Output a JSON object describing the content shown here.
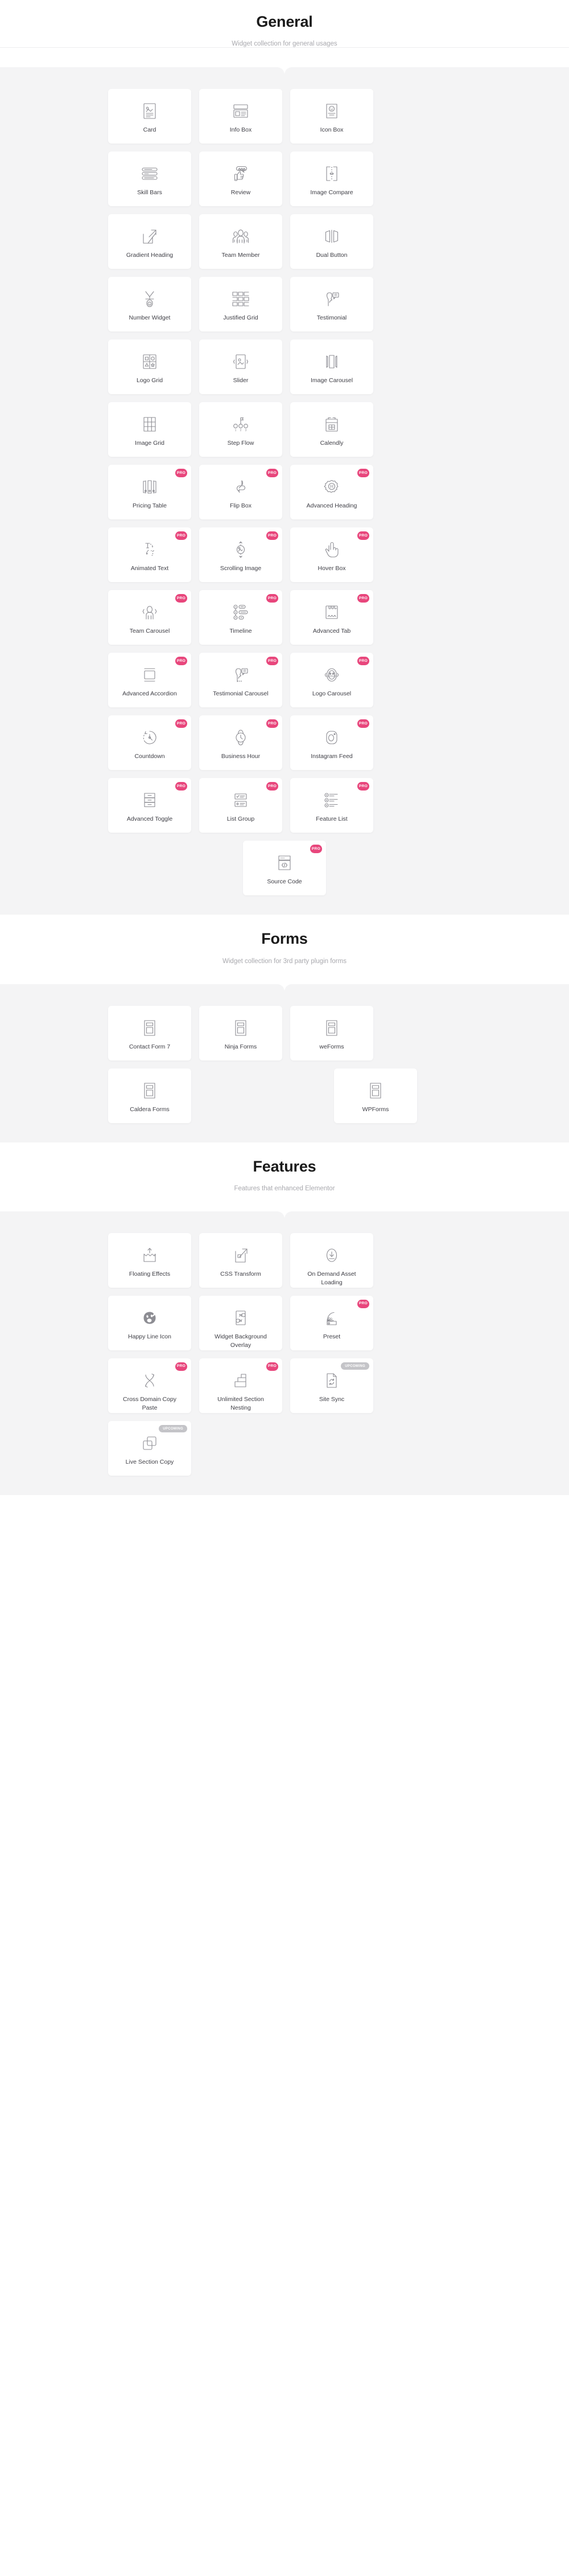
{
  "brand": {
    "pro_color": "#e8467c",
    "upcoming_color": "#c4c4c8",
    "band_background": "#f4f4f5",
    "card_background": "#ffffff",
    "icon_color": "#8d8d93"
  },
  "badges": {
    "pro": "PRO",
    "upcoming": "UPCOMING"
  },
  "sections": [
    {
      "id": "general",
      "title": "General",
      "subtitle": "Widget collection for general usages",
      "cards": [
        {
          "label": "Card",
          "icon": "card-icon",
          "badge": null
        },
        {
          "label": "Info Box",
          "icon": "info-box-icon",
          "badge": null
        },
        {
          "label": "Icon Box",
          "icon": "icon-box-icon",
          "badge": null
        },
        {
          "label": "Skill Bars",
          "icon": "skill-bars-icon",
          "badge": null
        },
        {
          "label": "Review",
          "icon": "review-icon",
          "badge": null
        },
        {
          "label": "Image Compare",
          "icon": "image-compare-icon",
          "badge": null
        },
        {
          "label": "Gradient Heading",
          "icon": "gradient-heading-icon",
          "badge": null
        },
        {
          "label": "Team Member",
          "icon": "team-member-icon",
          "badge": null
        },
        {
          "label": "Dual Button",
          "icon": "dual-button-icon",
          "badge": null
        },
        {
          "label": "Number Widget",
          "icon": "number-widget-icon",
          "badge": null
        },
        {
          "label": "Justified Grid",
          "icon": "justified-grid-icon",
          "badge": null
        },
        {
          "label": "Testimonial",
          "icon": "testimonial-icon",
          "badge": null
        },
        {
          "label": "Logo Grid",
          "icon": "logo-grid-icon",
          "badge": null
        },
        {
          "label": "Slider",
          "icon": "slider-icon",
          "badge": null
        },
        {
          "label": "Image Carousel",
          "icon": "image-carousel-icon",
          "badge": null
        },
        {
          "label": "Image Grid",
          "icon": "image-grid-icon",
          "badge": null
        },
        {
          "label": "Step Flow",
          "icon": "step-flow-icon",
          "badge": null
        },
        {
          "label": "Calendly",
          "icon": "calendly-icon",
          "badge": null
        },
        {
          "label": "Pricing Table",
          "icon": "pricing-table-icon",
          "badge": "PRO"
        },
        {
          "label": "Flip Box",
          "icon": "flip-box-icon",
          "badge": "PRO"
        },
        {
          "label": "Advanced Heading",
          "icon": "advanced-heading-icon",
          "badge": "PRO"
        },
        {
          "label": "Animated Text",
          "icon": "animated-text-icon",
          "badge": "PRO"
        },
        {
          "label": "Scrolling Image",
          "icon": "scrolling-image-icon",
          "badge": "PRO"
        },
        {
          "label": "Hover Box",
          "icon": "hover-box-icon",
          "badge": "PRO"
        },
        {
          "label": "Team Carousel",
          "icon": "team-carousel-icon",
          "badge": "PRO"
        },
        {
          "label": "Timeline",
          "icon": "timeline-icon",
          "badge": "PRO"
        },
        {
          "label": "Advanced Tab",
          "icon": "advanced-tab-icon",
          "badge": "PRO"
        },
        {
          "label": "Advanced Accordion",
          "icon": "advanced-accordion-icon",
          "badge": "PRO"
        },
        {
          "label": "Testimonial Carousel",
          "icon": "testimonial-carousel-icon",
          "badge": "PRO"
        },
        {
          "label": "Logo Carousel",
          "icon": "logo-carousel-icon",
          "badge": "PRO"
        },
        {
          "label": "Countdown",
          "icon": "countdown-icon",
          "badge": "PRO"
        },
        {
          "label": "Business Hour",
          "icon": "business-hour-icon",
          "badge": "PRO"
        },
        {
          "label": "Instagram Feed",
          "icon": "instagram-feed-icon",
          "badge": "PRO"
        },
        {
          "label": "Advanced Toggle",
          "icon": "advanced-toggle-icon",
          "badge": "PRO"
        },
        {
          "label": "List Group",
          "icon": "list-group-icon",
          "badge": "PRO"
        },
        {
          "label": "Feature List",
          "icon": "feature-list-icon",
          "badge": "PRO"
        },
        {
          "label": "Source Code",
          "icon": "source-code-icon",
          "badge": "PRO"
        }
      ]
    },
    {
      "id": "forms",
      "title": "Forms",
      "subtitle": "Widget collection for 3rd party plugin forms",
      "cards": [
        {
          "label": "Contact Form 7",
          "icon": "form-icon",
          "badge": null
        },
        {
          "label": "Ninja Forms",
          "icon": "form-icon",
          "badge": null
        },
        {
          "label": "weForms",
          "icon": "form-icon",
          "badge": null
        },
        {
          "label": "Caldera Forms",
          "icon": "form-icon",
          "badge": null
        },
        {
          "label": "WPForms",
          "icon": "form-icon",
          "badge": null
        }
      ]
    },
    {
      "id": "features",
      "title": "Features",
      "subtitle": "Features that enhanced Elementor",
      "cards": [
        {
          "label": "Floating Effects",
          "icon": "floating-effects-icon",
          "badge": null
        },
        {
          "label": "CSS Transform",
          "icon": "css-transform-icon",
          "badge": null
        },
        {
          "label": "On Demand Asset Loading",
          "icon": "on-demand-asset-loading-icon",
          "badge": null
        },
        {
          "label": "Happy Line Icon",
          "icon": "happy-line-icon",
          "badge": null
        },
        {
          "label": "Widget Background Overlay",
          "icon": "widget-background-overlay-icon",
          "badge": null
        },
        {
          "label": "Preset",
          "icon": "preset-icon",
          "badge": "PRO"
        },
        {
          "label": "Cross Domain Copy Paste",
          "icon": "cross-domain-copy-paste-icon",
          "badge": "PRO"
        },
        {
          "label": "Unlimited Section Nesting",
          "icon": "unlimited-section-nesting-icon",
          "badge": "PRO"
        },
        {
          "label": "Site Sync",
          "icon": "site-sync-icon",
          "badge": "UPCOMING"
        },
        {
          "label": "Live Section Copy",
          "icon": "live-section-copy-icon",
          "badge": "UPCOMING"
        }
      ]
    }
  ]
}
